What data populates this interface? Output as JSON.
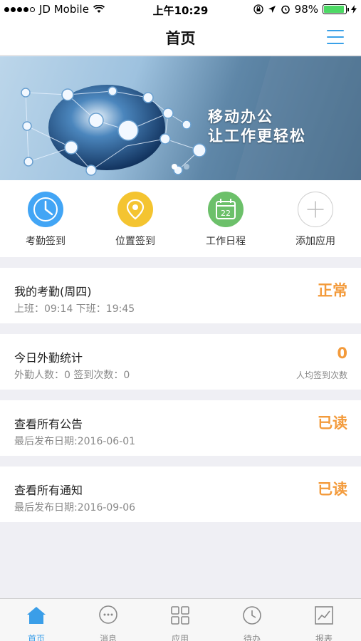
{
  "status_bar": {
    "carrier": "JD Mobile",
    "time": "上午10:29",
    "battery": "98%"
  },
  "nav": {
    "title": "首页"
  },
  "banner": {
    "line1": "移动办公",
    "line2": "让工作更轻松"
  },
  "quick_actions": [
    {
      "label": "考勤签到",
      "icon": "clock-icon",
      "color": "#42a5f5"
    },
    {
      "label": "位置签到",
      "icon": "location-pin-icon",
      "color": "#f4c430"
    },
    {
      "label": "工作日程",
      "icon": "calendar-icon",
      "color": "#6cc06a",
      "badge": "22"
    },
    {
      "label": "添加应用",
      "icon": "plus-icon",
      "color": "#cccccc"
    }
  ],
  "cards": {
    "attendance": {
      "title": "我的考勤(周四)",
      "sub": "上班：09:14  下班：19:45",
      "status": "正常"
    },
    "field": {
      "title": "今日外勤统计",
      "sub": "外勤人数：0  签到次数：0",
      "value": "0",
      "note": "人均签到次数"
    },
    "announcements": {
      "title": "查看所有公告",
      "sub": "最后发布日期:2016-06-01",
      "status": "已读"
    },
    "notices": {
      "title": "查看所有通知",
      "sub": "最后发布日期:2016-09-06",
      "status": "已读"
    }
  },
  "tabs": [
    {
      "label": "首页",
      "icon": "home-icon",
      "active": true
    },
    {
      "label": "消息",
      "icon": "message-icon"
    },
    {
      "label": "应用",
      "icon": "apps-grid-icon"
    },
    {
      "label": "待办",
      "icon": "clock-icon"
    },
    {
      "label": "报表",
      "icon": "chart-icon"
    }
  ],
  "colors": {
    "accent": "#3a9ee8",
    "orange": "#f39a3a"
  }
}
